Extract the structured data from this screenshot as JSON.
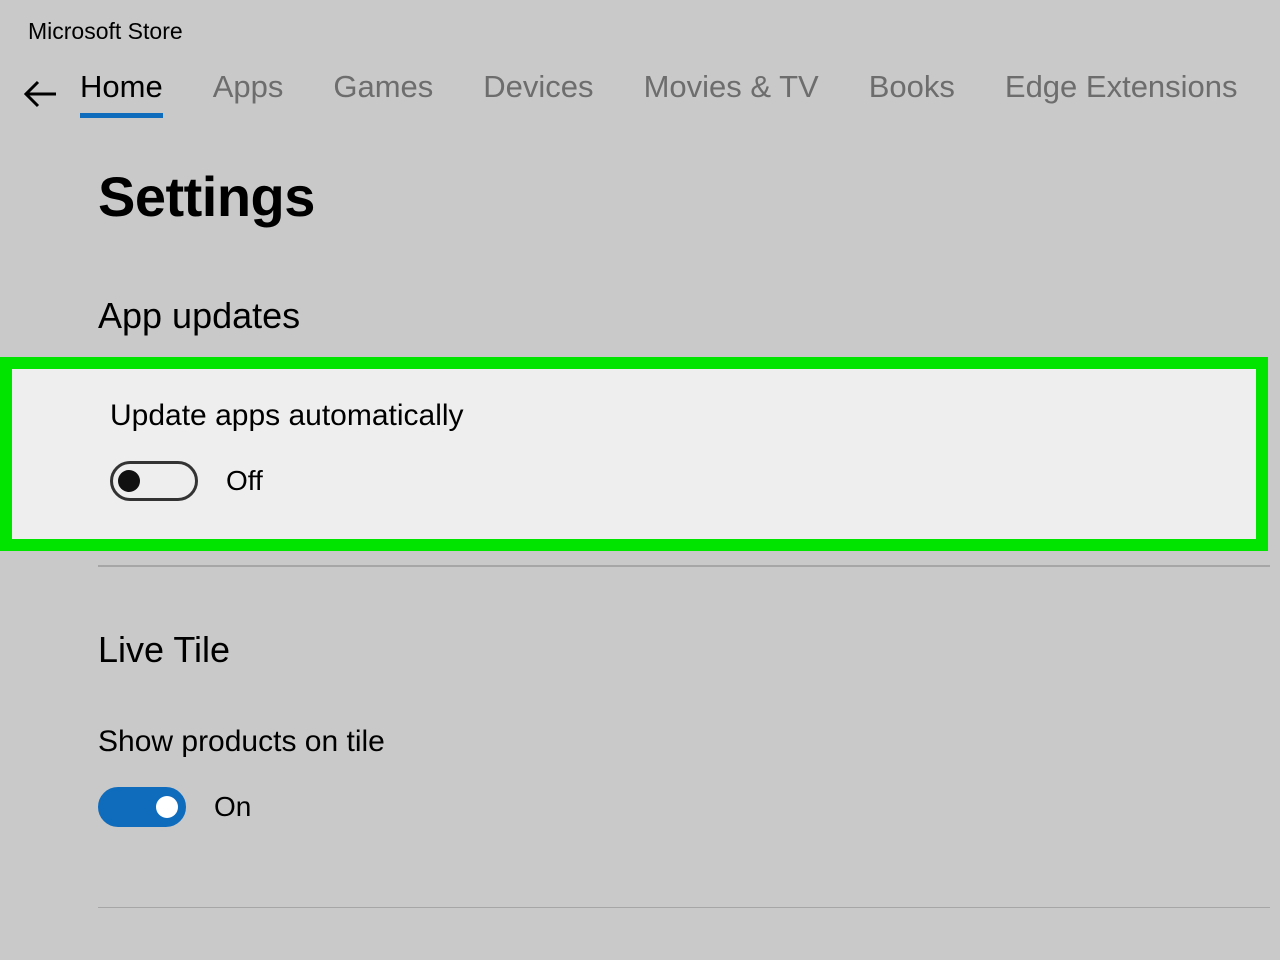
{
  "window": {
    "title": "Microsoft Store"
  },
  "nav": {
    "tabs": [
      {
        "label": "Home",
        "active": true
      },
      {
        "label": "Apps",
        "active": false
      },
      {
        "label": "Games",
        "active": false
      },
      {
        "label": "Devices",
        "active": false
      },
      {
        "label": "Movies & TV",
        "active": false
      },
      {
        "label": "Books",
        "active": false
      },
      {
        "label": "Edge Extensions",
        "active": false
      }
    ]
  },
  "page": {
    "title": "Settings"
  },
  "sections": {
    "app_updates": {
      "heading": "App updates",
      "setting_label": "Update apps automatically",
      "toggle_state": "Off",
      "highlighted": true
    },
    "live_tile": {
      "heading": "Live Tile",
      "setting_label": "Show products on tile",
      "toggle_state": "On"
    }
  },
  "colors": {
    "accent": "#0f6cbd",
    "highlight_border": "#00e400",
    "background": "#c9c9c9",
    "highlight_bg": "#eeeeee"
  }
}
